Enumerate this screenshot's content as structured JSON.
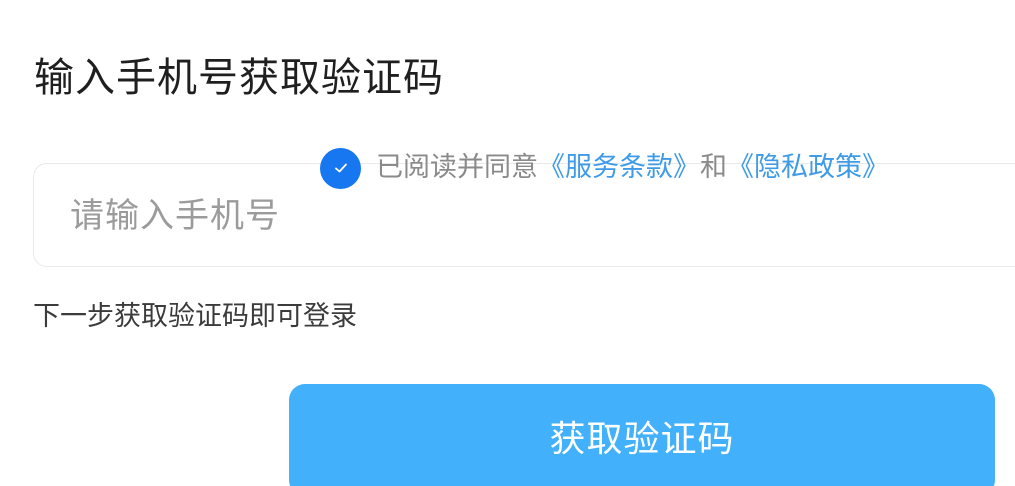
{
  "title": "输入手机号获取验证码",
  "phone": {
    "value": "",
    "placeholder": "请输入手机号"
  },
  "agreement": {
    "checked": true,
    "prefix": "已阅读并同意",
    "service_link": "《服务条款》",
    "conjunction": "和",
    "privacy_link": "《隐私政策》"
  },
  "hint": "下一步获取验证码即可登录",
  "button": {
    "label": "获取验证码"
  },
  "colors": {
    "accent": "#1677f1",
    "link": "#3f9be8",
    "button": "#42b0fb"
  },
  "icons": {
    "check": "check-icon"
  }
}
